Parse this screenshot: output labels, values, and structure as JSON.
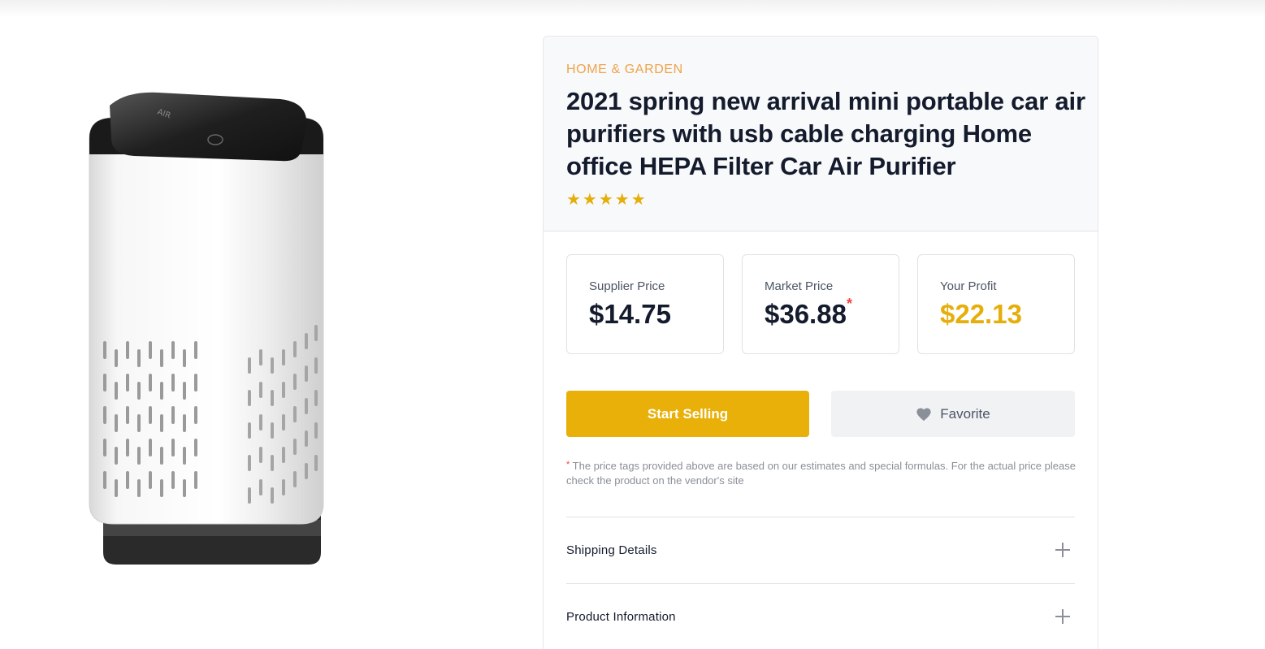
{
  "product": {
    "category": "HOME & GARDEN",
    "title": "2021 spring new arrival mini portable car air purifiers with usb cable charging Home office HEPA Filter Car Air Purifier",
    "rating": 5,
    "stars": "★★★★★",
    "image_label": "AIR"
  },
  "prices": {
    "supplier": {
      "label": "Supplier Price",
      "value": "$14.75"
    },
    "market": {
      "label": "Market Price",
      "value": "$36.88",
      "mark": "*"
    },
    "profit": {
      "label": "Your Profit",
      "value": "$22.13"
    }
  },
  "actions": {
    "start_selling": "Start Selling",
    "favorite": "Favorite"
  },
  "disclaimer": {
    "mark": "*",
    "text": "The price tags provided above are based on our estimates and special formulas. For the actual price please check the product on the vendor's site"
  },
  "accordion": [
    {
      "label": "Shipping Details"
    },
    {
      "label": "Product Information"
    }
  ],
  "colors": {
    "accent": "#e8b008",
    "category": "#f0a24a",
    "asterisk": "#ef4444"
  },
  "icons": {
    "favorite": "heart-icon",
    "expand": "plus-icon"
  }
}
